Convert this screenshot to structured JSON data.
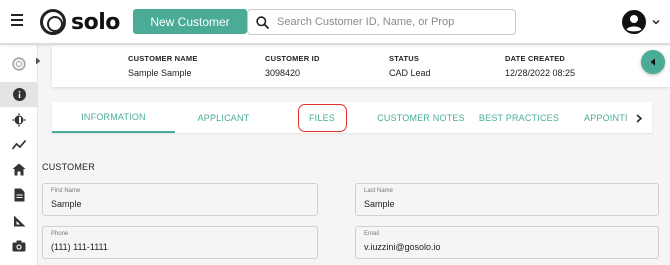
{
  "header": {
    "logo_text": "solo",
    "new_customer_label": "New Customer",
    "search_placeholder": "Search Customer ID, Name, or Prop"
  },
  "sidebar": {
    "items": [
      {
        "icon": "solo-logo-icon"
      },
      {
        "icon": "info-icon"
      },
      {
        "icon": "lightbulb-icon"
      },
      {
        "icon": "activity-icon"
      },
      {
        "icon": "home-icon"
      },
      {
        "icon": "document-icon"
      },
      {
        "icon": "ruler-icon"
      },
      {
        "icon": "camera-icon"
      }
    ]
  },
  "summary": {
    "customer_name": {
      "label": "CUSTOMER NAME",
      "value": "Sample Sample"
    },
    "customer_id": {
      "label": "CUSTOMER ID",
      "value": "3098420"
    },
    "status": {
      "label": "STATUS",
      "value": "CAD Lead"
    },
    "date_created": {
      "label": "DATE CREATED",
      "value": "12/28/2022 08:25"
    }
  },
  "tabs": [
    {
      "label": "INFORMATION",
      "active": true
    },
    {
      "label": "APPLICANT"
    },
    {
      "label": "FILES"
    },
    {
      "label": "CUSTOMER NOTES"
    },
    {
      "label": "BEST PRACTICES"
    },
    {
      "label": "APPOINTI"
    }
  ],
  "customer": {
    "section_title": "CUSTOMER",
    "fields": {
      "first_name": {
        "label": "First Name",
        "value": "Sample"
      },
      "last_name": {
        "label": "Last Name",
        "value": "Sample"
      },
      "phone": {
        "label": "Phone",
        "value": "(111) 111-1111"
      },
      "email": {
        "label": "Email",
        "value": "v.iuzzini@gosolo.io"
      }
    }
  },
  "colors": {
    "accent": "#4aab96",
    "highlight_circle": "#e03030"
  }
}
